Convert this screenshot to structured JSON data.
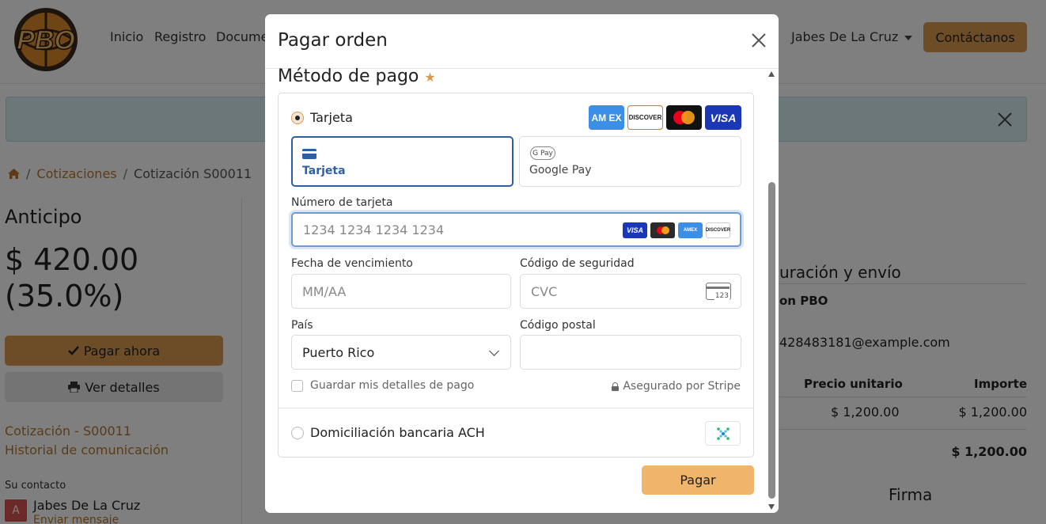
{
  "nav": {
    "links": [
      "Inicio",
      "Registro",
      "Docume"
    ],
    "user": "Jabes De La Cruz",
    "contact_label": "Contáctanos",
    "logo_text": "PBO"
  },
  "breadcrumb": {
    "section": "Cotizaciones",
    "current": "Cotización S00011"
  },
  "sidebar": {
    "anticipo_label": "Anticipo",
    "anticipo_value": "$ 420.00 (35.0%)",
    "pay_now_label": "Pagar ahora",
    "view_details_label": "Ver detalles",
    "quote_link": "Cotización - S00011",
    "history_link": "Historial de comunicación",
    "contact_title": "Su contacto",
    "avatar_initial": "A",
    "contact_name": "Jabes De La Cruz",
    "contact_message": "Enviar mensaje"
  },
  "right": {
    "config_title": "uración y envío",
    "config_sub": "on PBO",
    "email": "428483181@example.com",
    "col_unit_price": "Precio unitario",
    "col_amount": "Importe",
    "unit_price": "$ 1,200.00",
    "amount": "$ 1,200.00",
    "total": "$ 1,200.00",
    "signature_title": "Firma"
  },
  "modal": {
    "title": "Pagar orden",
    "method_title": "Método de pago",
    "card_option_label": "Tarjeta",
    "brands": {
      "amex": "AM EX",
      "discover": "DISCOVER",
      "visa": "VISA"
    },
    "tabs": [
      {
        "label": "Tarjeta",
        "active": true
      },
      {
        "label": "Google Pay",
        "active": false,
        "icon_text": "G Pay"
      }
    ],
    "card_number": {
      "label": "Número de tarjeta",
      "placeholder": "1234 1234 1234 1234"
    },
    "mini_brands": {
      "visa": "VISA",
      "amex": "AMEX",
      "discover": "DISCOVER"
    },
    "expiry": {
      "label": "Fecha de vencimiento",
      "placeholder": "MM/AA"
    },
    "cvc": {
      "label": "Código de seguridad",
      "placeholder": "CVC",
      "icon_text": "123"
    },
    "country": {
      "label": "País",
      "value": "Puerto Rico"
    },
    "postal": {
      "label": "Código postal",
      "value": ""
    },
    "save_details_label": "Guardar mis detalles de pago",
    "secured_label": "Asegurado por Stripe",
    "ach_label": "Domiciliación bancaria ACH",
    "submit_label": "Pagar"
  },
  "colors": {
    "accent": "#d99a4e",
    "link": "#b8782f",
    "focus_blue": "#2c5fa8",
    "submit": "#f0b46a"
  }
}
